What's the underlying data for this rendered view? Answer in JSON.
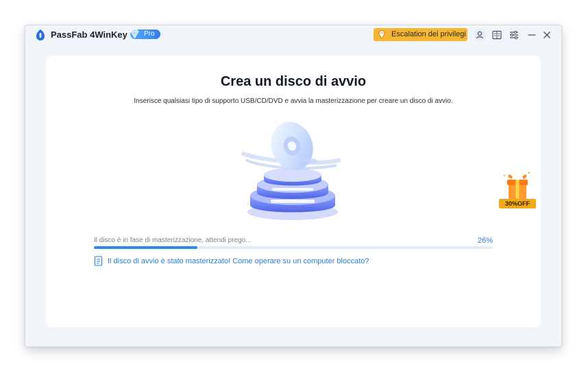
{
  "app": {
    "name": "PassFab 4WinKey",
    "badge": "Pro"
  },
  "toolbar": {
    "escalation_label": "Escalation dei privilegi",
    "icons": [
      "user-icon",
      "feedback-icon",
      "settings-icon",
      "minimize-icon",
      "close-icon"
    ]
  },
  "main": {
    "title": "Crea un disco di avvio",
    "subtitle": "Inserisce qualsiasi tipo di supporto USB/CD/DVD e avvia la masterizzazione per creare un disco di avvio.",
    "progress": {
      "status": "Il disco è in fase di masterizzazione, attendi prego...",
      "percent_label": "26%",
      "value": 0.26
    },
    "help_link": "Il disco di avvio è stato masterizzato! Come operare su un computer bloccato?"
  },
  "promo": {
    "label": "30%OFF"
  },
  "colors": {
    "accent": "#2b8be8",
    "escalation": "#f5b731",
    "promo": "#f2a81b"
  }
}
